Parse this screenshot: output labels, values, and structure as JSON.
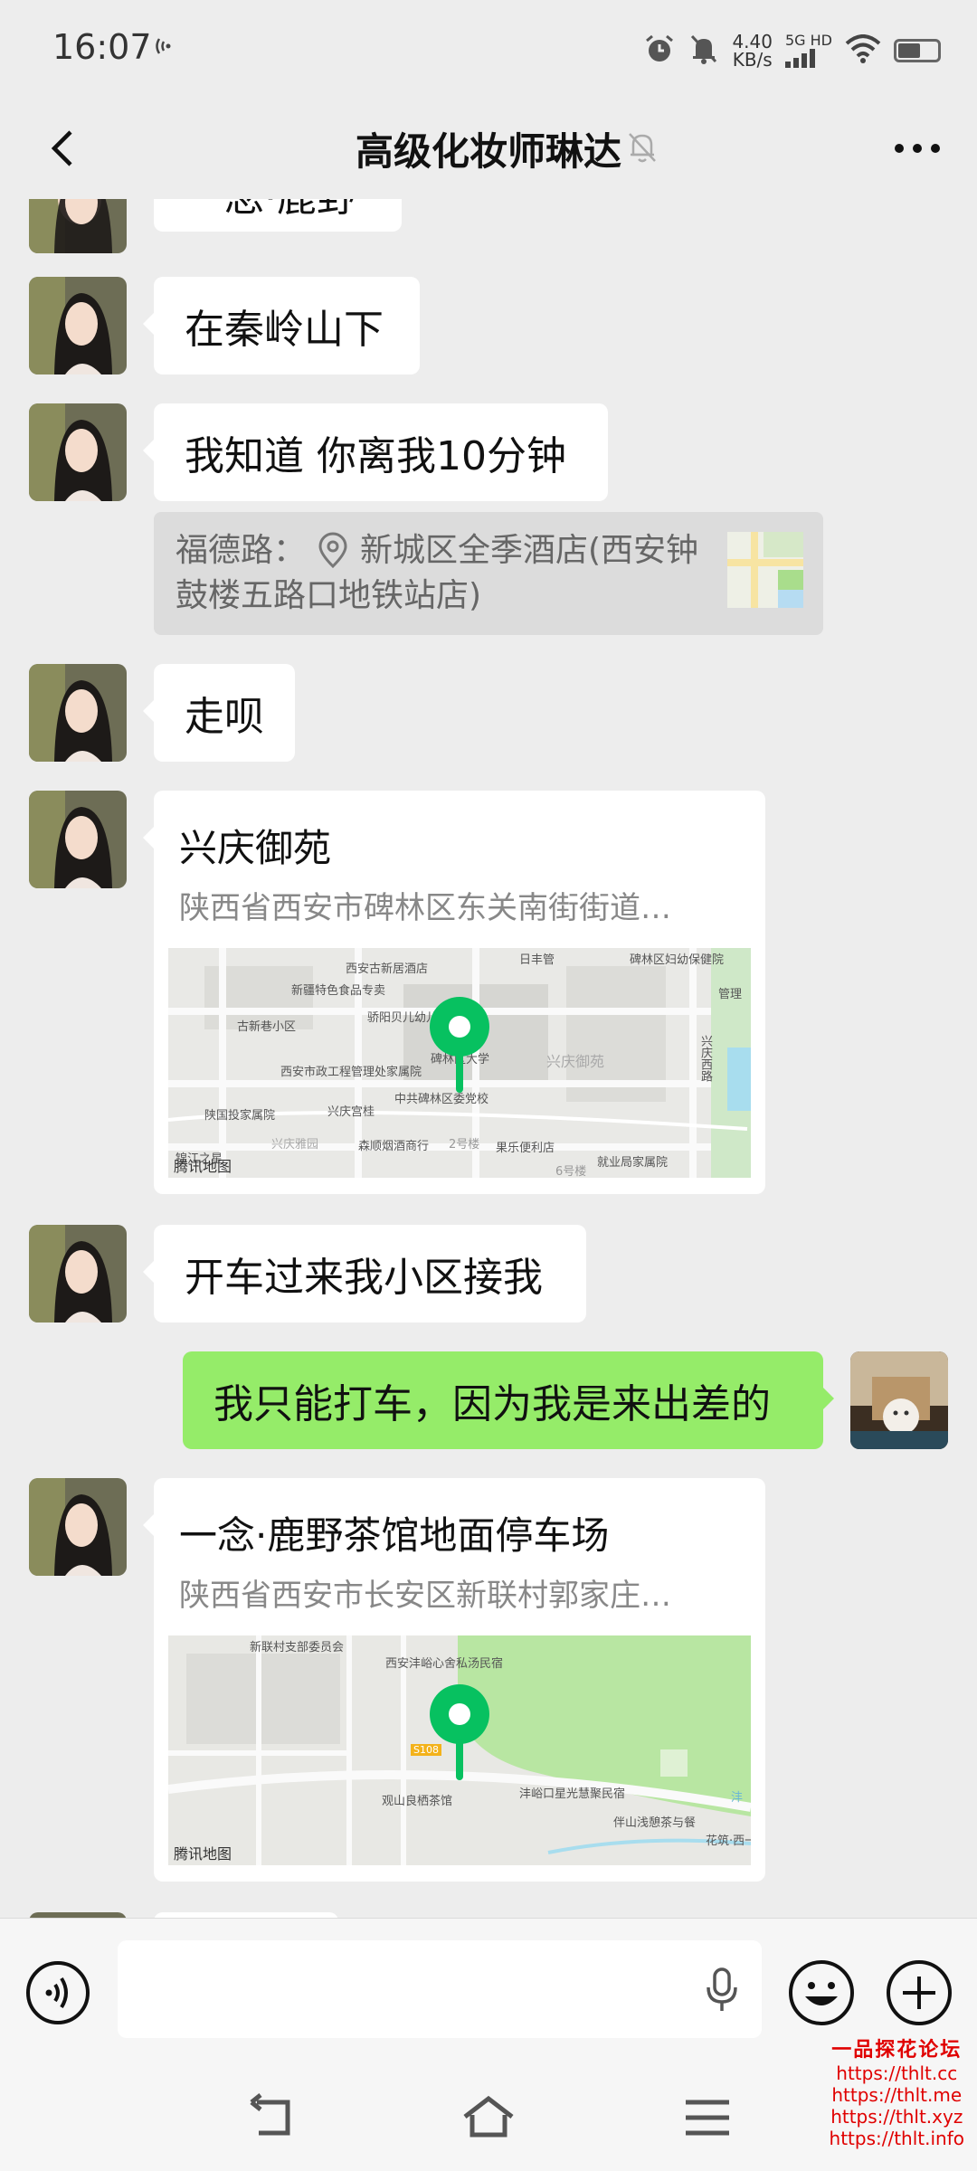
{
  "status_bar": {
    "time": "16:07",
    "net_speed_value": "4.40",
    "net_speed_unit": "KB/s",
    "net_type": "5G HD"
  },
  "nav": {
    "title": "高级化妆师琳达"
  },
  "messages": {
    "partial_top": "一念·鹿野",
    "m1": "在秦岭山下",
    "m2": "我知道 你离我10分钟",
    "quote": {
      "label": "福德路：",
      "text_line1": "新城区全季酒店(西安钟",
      "text_line2": "鼓楼五路口地铁站店)"
    },
    "m3": "走呗",
    "loc1": {
      "title": "兴庆御苑",
      "address": "陕西省西安市碑林区东关南街街道…",
      "map_credit": "腾讯地图",
      "map_labels": [
        "西安古新居酒店",
        "日丰管",
        "碑林区妇幼保健院",
        "新疆特色食品专卖",
        "古新巷小区",
        "骄阳贝儿幼儿园",
        "西安市政工程管理处家属院",
        "碑林区大学",
        "兴庆御苑",
        "陕国投家属院",
        "兴庆宫桂",
        "中共碑林区委党校",
        "森顺烟酒商行",
        "果乐便利店",
        "就业局家属院",
        "兴庆西路",
        "兴庆雅园",
        "锦江之星",
        "2号楼",
        "6号楼",
        "管理"
      ]
    },
    "m4": "开车过来我小区接我",
    "m5_self": "我只能打车，因为我是来出差的",
    "loc2": {
      "title": "一念·鹿野茶馆地面停车场",
      "address": "陕西省西安市长安区新联村郭家庄…",
      "map_credit": "腾讯地图",
      "map_labels": [
        "新联村支部委员会",
        "西安沣峪心舍私汤民宿",
        "S108",
        "观山良栖茶馆",
        "沣峪口星光慧聚民宿",
        "伴山浅憩茶与餐",
        "花筑·西一山茶",
        "沣"
      ]
    }
  },
  "input": {
    "placeholder": ""
  },
  "watermark": {
    "title": "一品探花论坛",
    "urls": [
      "https://thlt.cc",
      "https://thlt.me",
      "https://thlt.xyz",
      "https://thlt.info"
    ]
  },
  "colors": {
    "background": "#ededed",
    "self_bubble": "#95ec69",
    "pin_green": "#07c160",
    "watermark_red": "#e00000"
  }
}
